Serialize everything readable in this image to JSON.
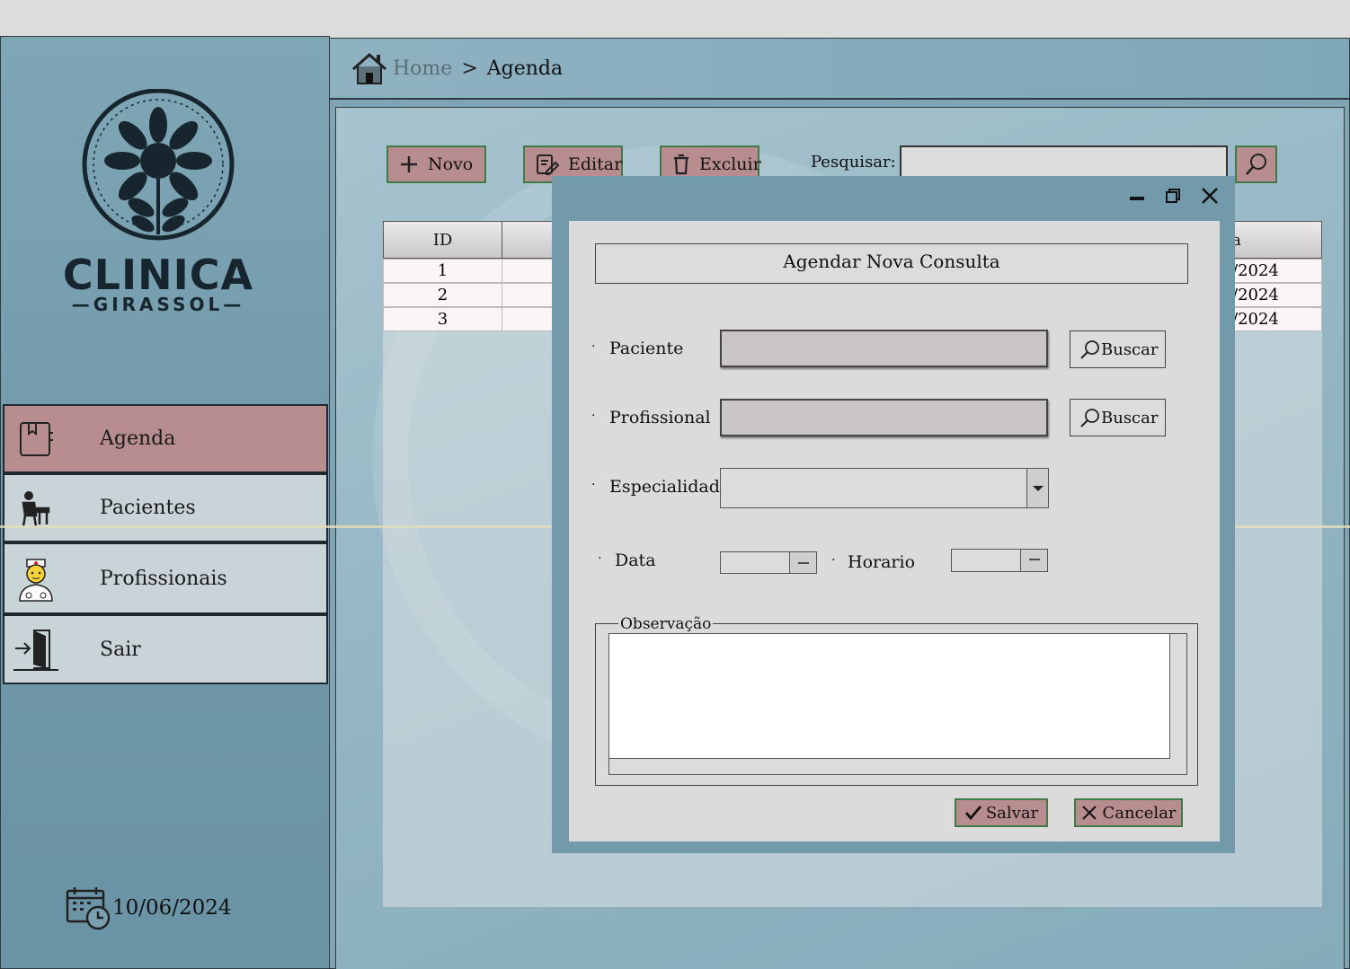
{
  "breadcrumb": {
    "home": "Home",
    "separator": ">",
    "current": "Agenda"
  },
  "brand": {
    "line1": "CLINICA",
    "line2": "GIRASSOL"
  },
  "sidebar": {
    "items": [
      {
        "label": "Agenda",
        "icon": "agenda-book-icon",
        "active": true
      },
      {
        "label": "Pacientes",
        "icon": "patient-icon",
        "active": false
      },
      {
        "label": "Profissionais",
        "icon": "nurse-icon",
        "active": false
      },
      {
        "label": "Sair",
        "icon": "exit-door-icon",
        "active": false
      }
    ],
    "date": "10/06/2024"
  },
  "toolbar": {
    "new_label": "Novo",
    "edit_label": "Editar",
    "delete_label": "Excluir",
    "search_label": "Pesquisar:",
    "search_value": ""
  },
  "table": {
    "columns": [
      "ID",
      "",
      "ta"
    ],
    "rows": [
      {
        "id": "1",
        "date_tail": "/2024"
      },
      {
        "id": "2",
        "date_tail": "/2024"
      },
      {
        "id": "3",
        "date_tail": "/2024"
      }
    ]
  },
  "dialog": {
    "title": "Agendar Nova Consulta",
    "bullet": "·",
    "patient_label": "Paciente",
    "patient_value": "",
    "professional_label": "Profissional",
    "professional_value": "",
    "search_button": "Buscar",
    "specialty_label": "Especialidade",
    "specialty_value": "",
    "date_label": "Data",
    "date_value": "",
    "time_label": "Horario",
    "time_value": "",
    "notes_label": "Observação",
    "notes_value": "",
    "save_label": "Salvar",
    "cancel_label": "Cancelar"
  },
  "colors": {
    "sidebar_bg": "#739aab",
    "active_nav": "#b88d90",
    "button_fill": "#b88d90",
    "button_border": "#3f7a47"
  }
}
